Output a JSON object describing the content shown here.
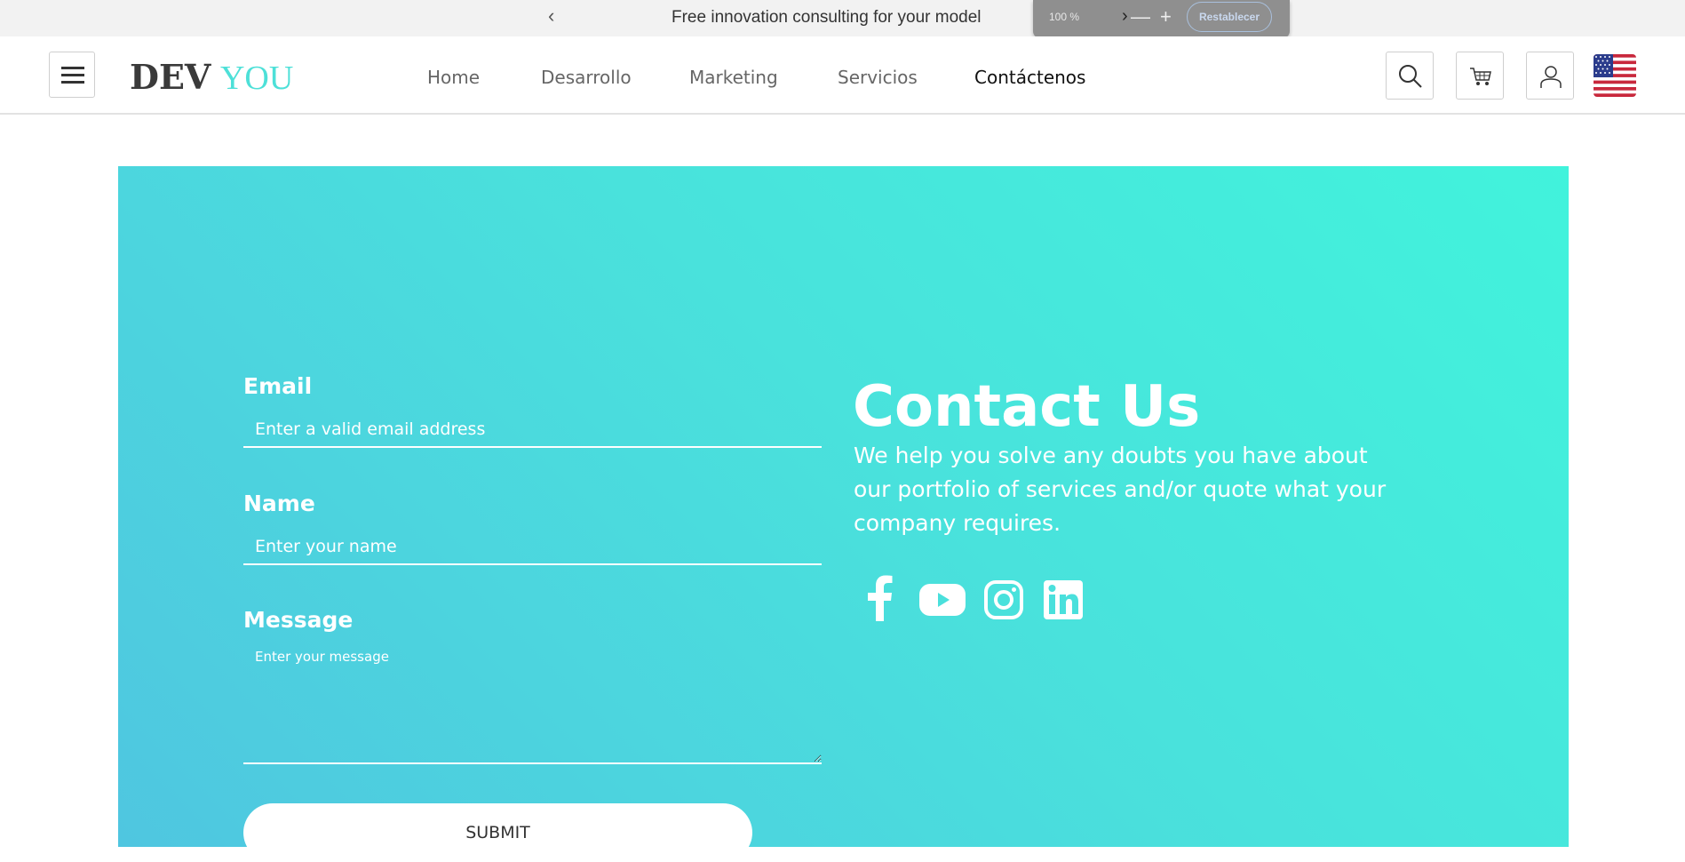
{
  "announcement": {
    "text": "Free innovation consulting for your model",
    "prev_icon": "‹"
  },
  "zoom": {
    "level": "100 %",
    "next_icon": "›",
    "minus": "—",
    "plus": "+",
    "reset_label": "Restablecer"
  },
  "header": {
    "logo_dev": "DEV",
    "logo_you": "YOU",
    "nav": [
      {
        "label": "Home"
      },
      {
        "label": "Desarrollo"
      },
      {
        "label": "Marketing"
      },
      {
        "label": "Servicios"
      },
      {
        "label": "Contáctenos"
      }
    ]
  },
  "form": {
    "email_label": "Email",
    "email_placeholder": "Enter a valid email address",
    "name_label": "Name",
    "name_placeholder": "Enter your name",
    "message_label": "Message",
    "message_placeholder": "Enter your message",
    "submit_label": "SUBMIT"
  },
  "contact": {
    "title": "Contact Us",
    "text": "We help you solve any doubts you have about our portfolio of services and/or quote what your company requires.",
    "social": [
      "facebook-icon",
      "youtube-icon",
      "instagram-icon",
      "linkedin-icon"
    ]
  },
  "colors": {
    "accent": "#4de0d8",
    "gradient_start": "#4fc6e0",
    "gradient_end": "#41f3dc"
  }
}
